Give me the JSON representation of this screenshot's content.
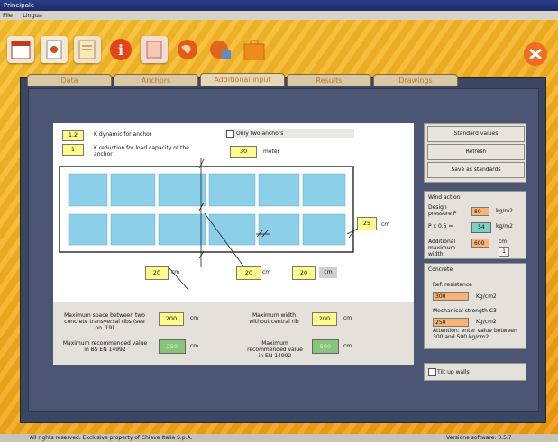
{
  "window_title": "Principale",
  "menu": [
    "File",
    "Lingua"
  ],
  "toolbar_icons": [
    "calendar-icon",
    "anchor-doc-icon",
    "document-icon",
    "info-icon",
    "book-icon",
    "globe-icon",
    "world-user-icon",
    "briefcase-icon"
  ],
  "exit_icon": "exit-icon",
  "tabs": [
    "Data",
    "Anchors",
    "Additional input",
    "Results",
    "Drawings"
  ],
  "active_tab": "Additional input",
  "params": {
    "k_dynamic_value": "1.2",
    "k_dynamic_label": "K dynamic for anchor",
    "k_reduction_value": "1",
    "k_reduction_label": "K reduction for load capacity of the anchor",
    "only_two_anchors": "Only two anchors",
    "meter_value": "30",
    "meter_label": "meter"
  },
  "dims": {
    "right": "25",
    "right_unit": "cm",
    "left_bottom": "20",
    "left_bottom_unit": "cm",
    "mid_bottom": "20",
    "mid_bottom_unit": "cm",
    "span": "20",
    "span_unit": "cm"
  },
  "lower": {
    "max_space_label": "Maximum space between two concrete transversal ribs (see no. 19)",
    "max_space_value": "200",
    "max_space_unit": "cm",
    "max_width_label": "Maximum width without central rib",
    "max_width_value": "200",
    "max_width_unit": "cm",
    "recommended_en_label": "Maximum recommended value in BS EN 14992",
    "recommended_en_value": "250",
    "recommended_en_unit": "cm",
    "recommended_en2_label": "Maximum recommended value in EN 14992",
    "recommended_en2_value": "500",
    "recommended_en2_unit": "cm"
  },
  "buttons": {
    "standard_values": "Standard values",
    "refresh": "Refresh",
    "save_as_standards": "Save as standards"
  },
  "wind": {
    "title": "Wind action",
    "design_pressure_label": "Design pressure P",
    "design_pressure_value": "80",
    "design_pressure_unit": "kg/m2",
    "p_factor_label": "P x 0.5 =",
    "p_factor_value": "54",
    "p_factor_unit": "kg/m2",
    "additional_label": "Additional maximum width",
    "additional_value": "600",
    "additional_unit": "cm",
    "spinner": "1"
  },
  "concrete": {
    "title": "Concrete",
    "ref_resistance_label": "Ref. resistance",
    "ref_resistance_value": "300",
    "ref_resistance_unit": "Kg/cm2",
    "mech_strength_label": "Mechanical strength C3",
    "mech_strength_value": "250",
    "mech_strength_unit": "Kg/cm2",
    "note": "Attention: enter value between 300 and 500 kg/cm2"
  },
  "tilt_up": "Tilt up walls",
  "footer": {
    "left": "All rights reserved. Exclusive property of Chiave Italia S.p.A.",
    "right": "Versione software: 3.5.7"
  }
}
